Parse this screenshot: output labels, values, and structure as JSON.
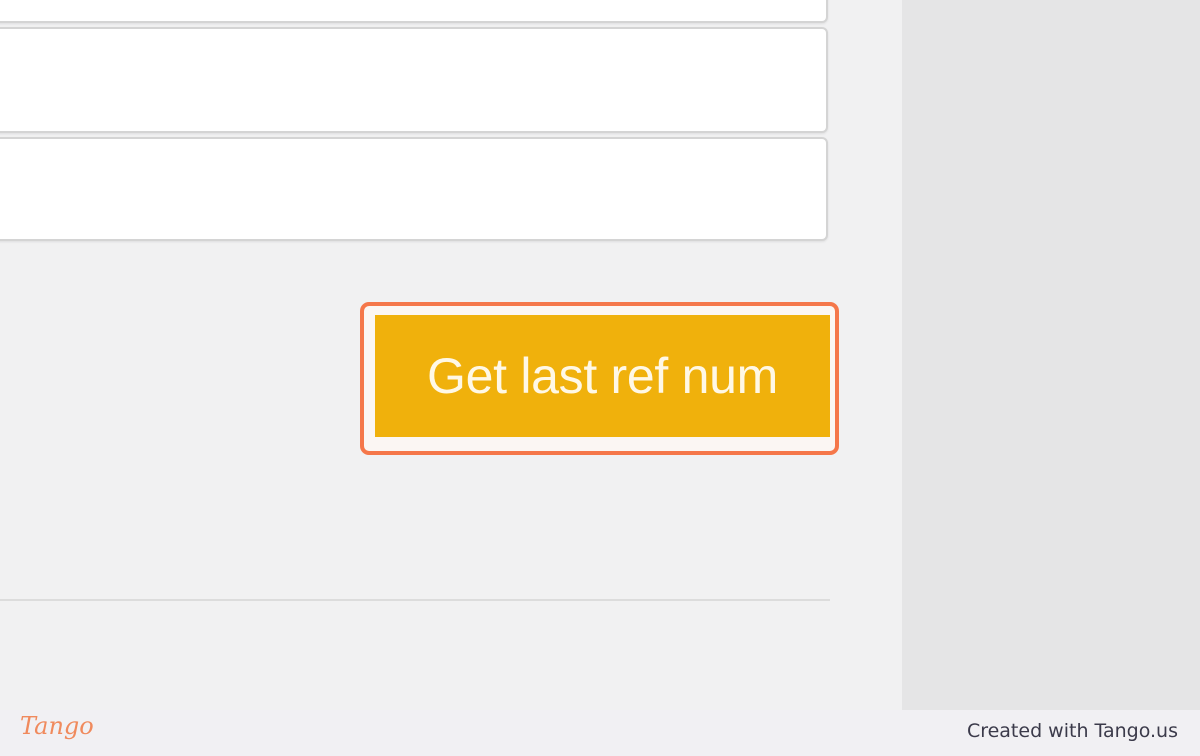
{
  "form": {
    "fields": [
      {
        "value": ""
      },
      {
        "value": ""
      },
      {
        "value": ""
      }
    ],
    "action_button_label": "Get last ref num"
  },
  "footer": {
    "logo_text": "Tango",
    "credit_text": "Created with Tango.us"
  },
  "colors": {
    "button_bg": "#f0b10c",
    "highlight_border": "#f5774a",
    "brand_orange": "#f08a5d"
  }
}
